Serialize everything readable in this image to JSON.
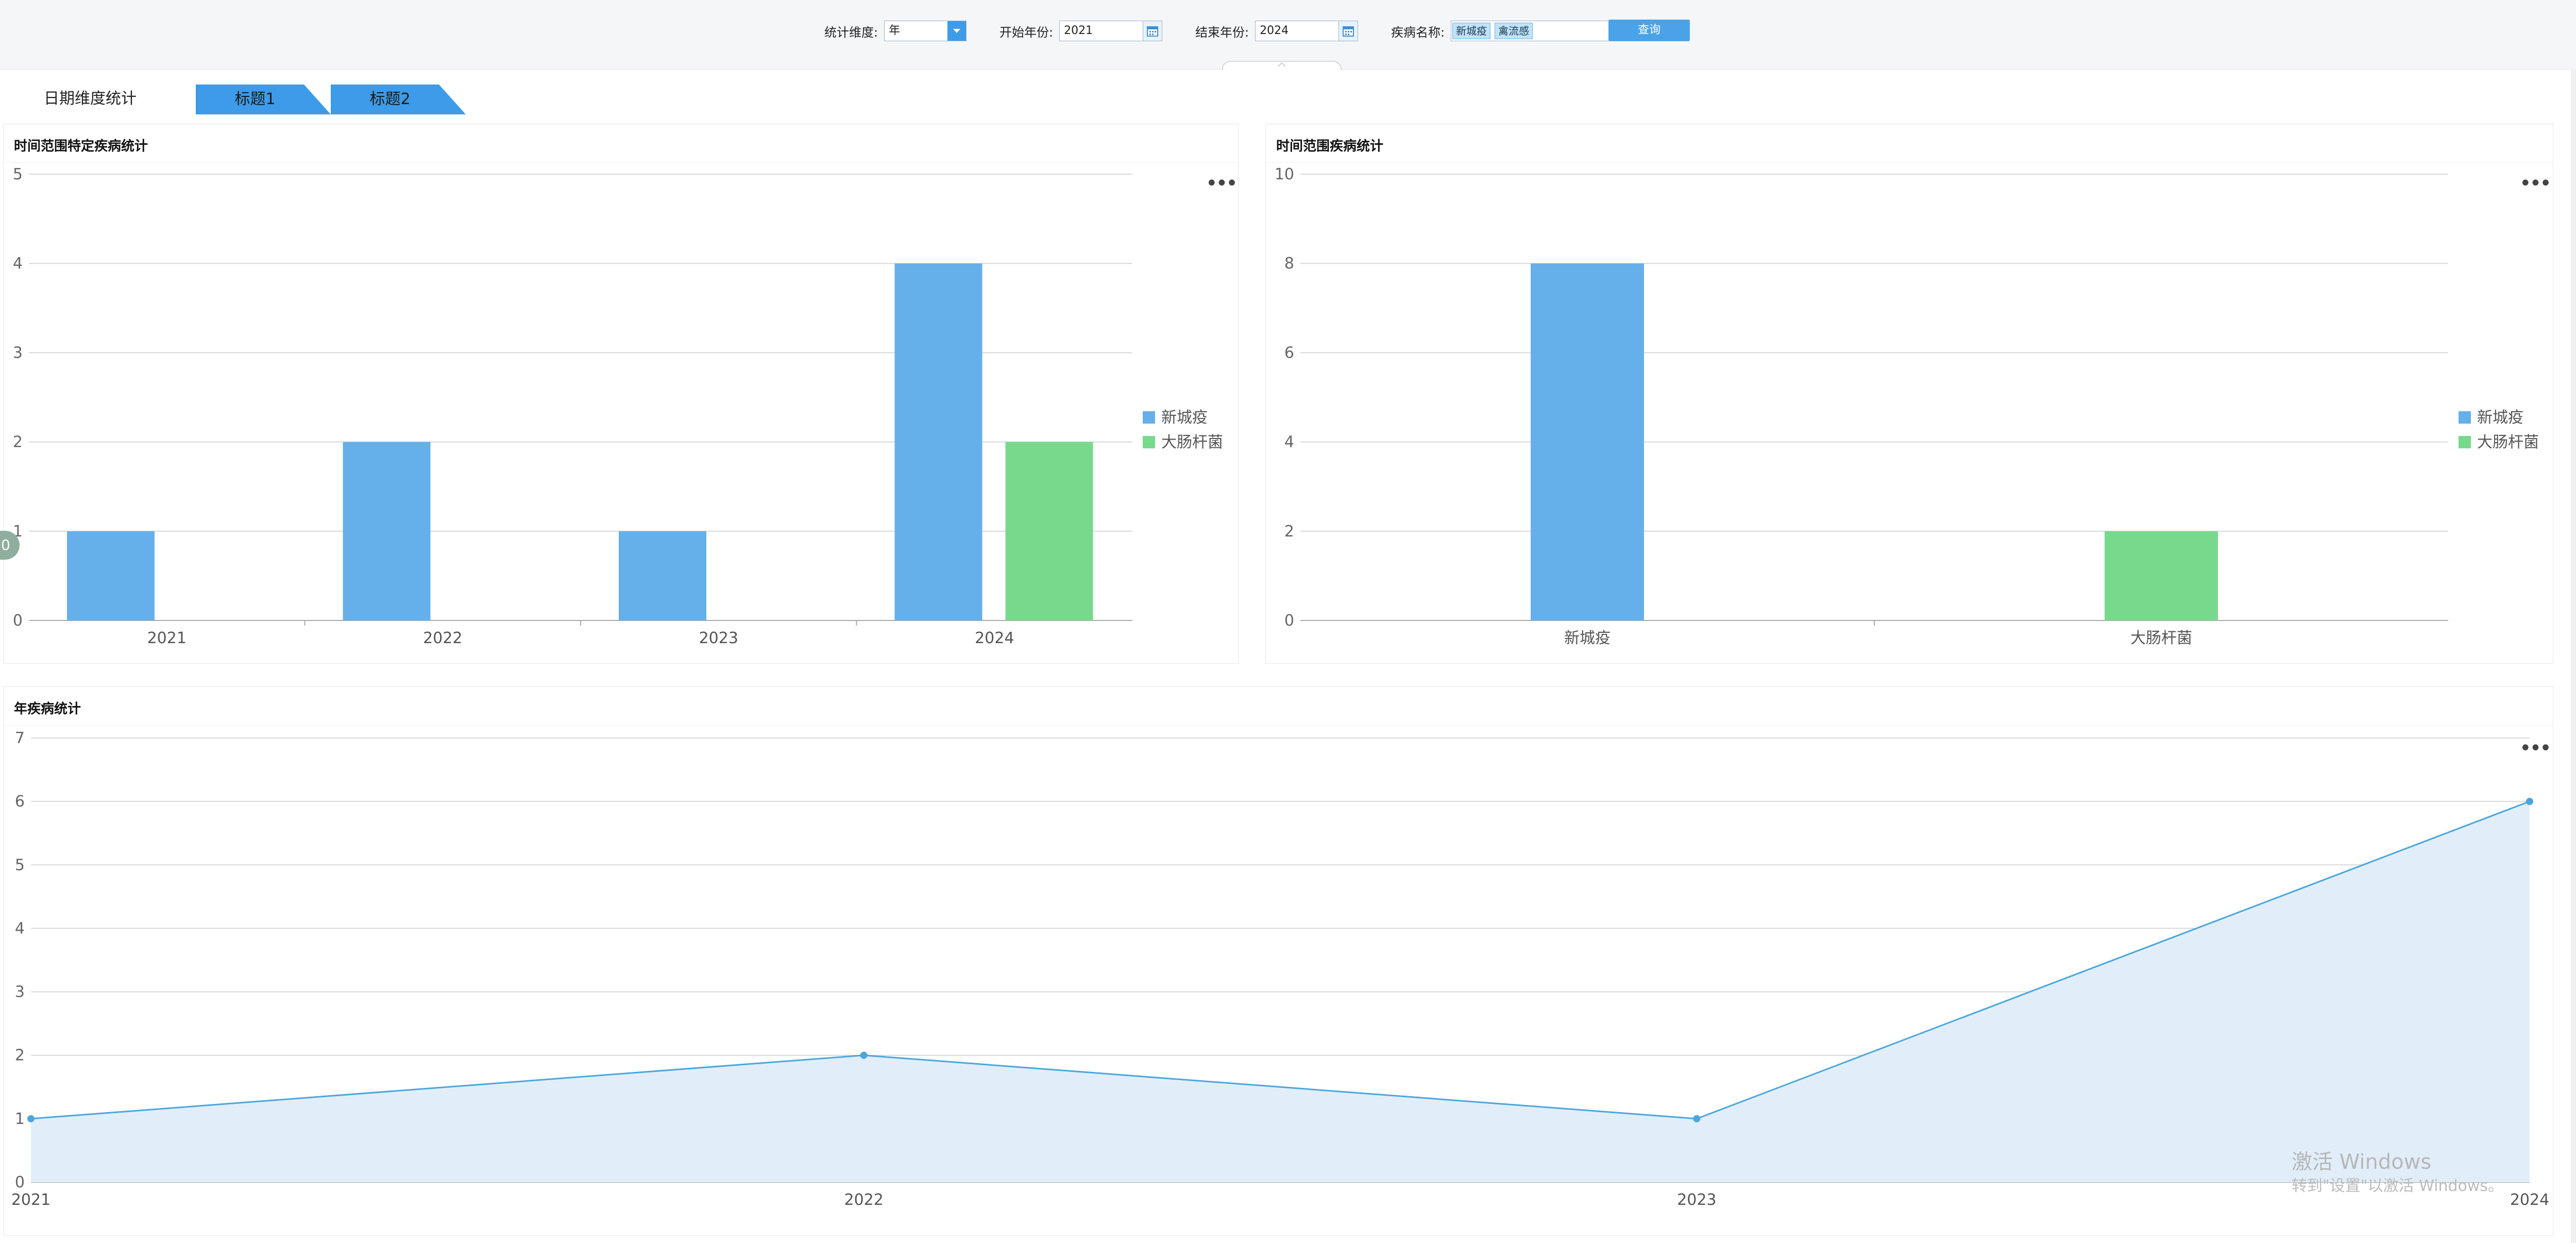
{
  "filters": {
    "dimension_label": "统计维度:",
    "dimension_value": "年",
    "start_label": "开始年份:",
    "start_value": "2021",
    "end_label": "结束年份:",
    "end_value": "2024",
    "disease_label": "疾病名称:",
    "disease_tags": [
      "新城疫",
      "禽流感"
    ],
    "query_label": "查询"
  },
  "tabs": {
    "first": "日期维度统计",
    "items": [
      "标题1",
      "标题2"
    ],
    "tab_color": "#3d9be9"
  },
  "side_tab_label": "0",
  "colors": {
    "blue": "#65b0ea",
    "green": "#78d98d",
    "line": "#4aa6de",
    "area": "#e1eefa"
  },
  "watermark": {
    "line1": "激活 Windows",
    "line2": "转到\"设置\"以激活 Windows。"
  },
  "chart_data": [
    {
      "id": "chart1",
      "type": "bar",
      "title": "时间范围特定疾病统计",
      "categories": [
        "2021",
        "2022",
        "2023",
        "2024"
      ],
      "series": [
        {
          "name": "新城疫",
          "values": [
            1,
            2,
            1,
            4
          ]
        },
        {
          "name": "大肠杆菌",
          "values": [
            0,
            0,
            0,
            2
          ]
        }
      ],
      "ylim": [
        0,
        5
      ],
      "yticks": [
        0,
        1,
        2,
        3,
        4,
        5
      ],
      "grid": true,
      "legend": "right"
    },
    {
      "id": "chart2",
      "type": "bar",
      "title": "时间范围疾病统计",
      "categories": [
        "新城疫",
        "大肠杆菌"
      ],
      "values": [
        8,
        2
      ],
      "series_names": [
        "新城疫",
        "大肠杆菌"
      ],
      "ylim": [
        0,
        10
      ],
      "yticks": [
        0,
        2,
        4,
        6,
        8,
        10
      ],
      "grid": true,
      "legend": "right"
    },
    {
      "id": "chart3",
      "type": "area",
      "title": "年疾病统计",
      "x": [
        "2021",
        "2022",
        "2023",
        "2024"
      ],
      "values": [
        1,
        2,
        1,
        6
      ],
      "ylim": [
        0,
        7
      ],
      "yticks": [
        0,
        1,
        2,
        3,
        4,
        5,
        6,
        7
      ],
      "grid": true
    }
  ]
}
